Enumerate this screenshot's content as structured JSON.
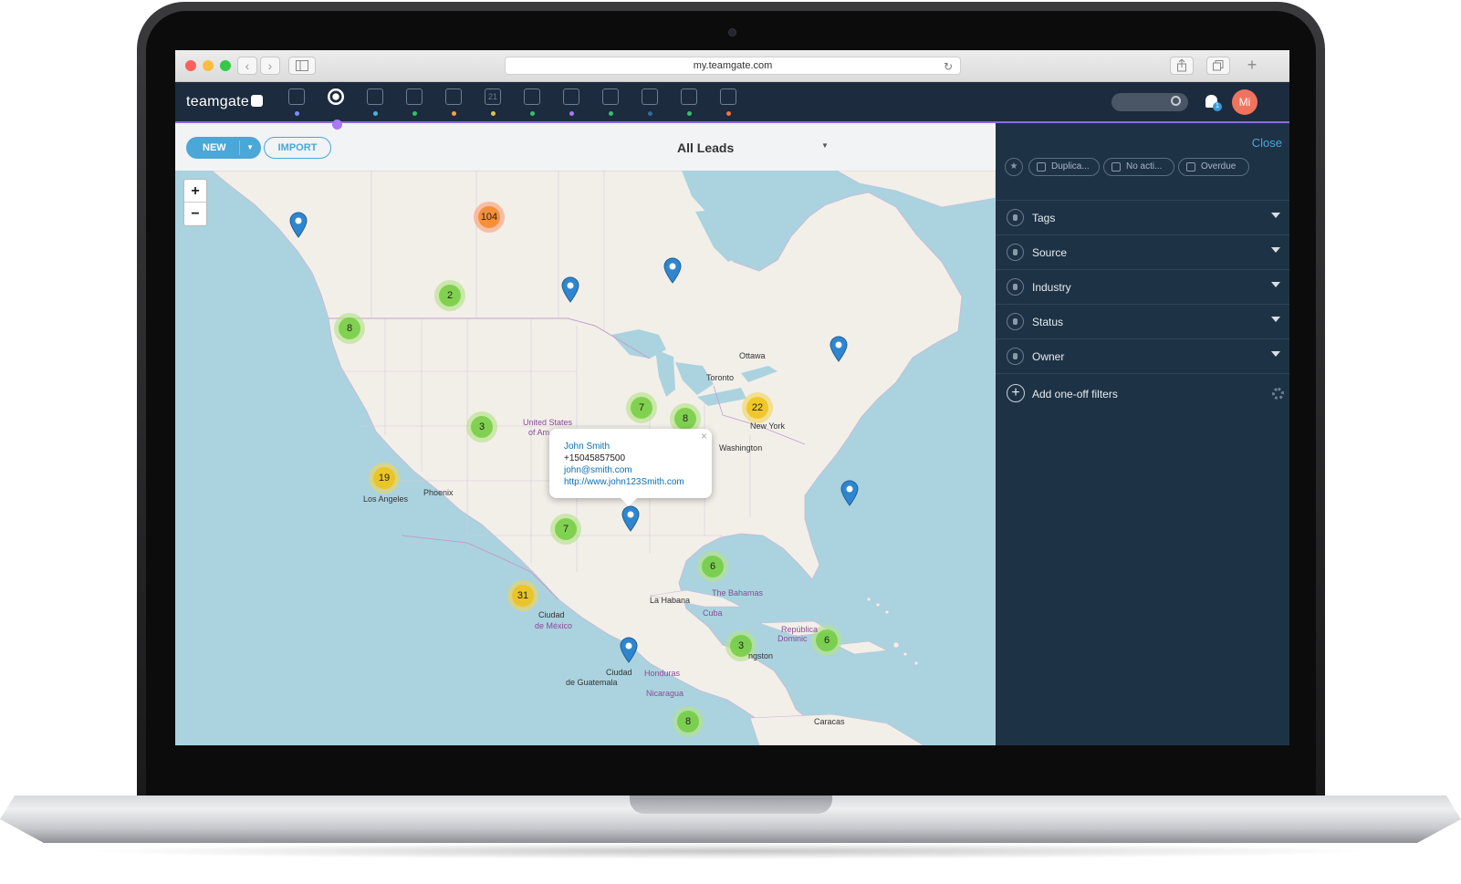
{
  "browser": {
    "url": "my.teamgate.com",
    "back": "‹",
    "forward": "›"
  },
  "app": {
    "logo": "teamgate",
    "nav_icons": [
      {
        "name": "dashboard-icon",
        "color": "#7d8cff"
      },
      {
        "name": "leads-icon",
        "color": "#a879f0"
      },
      {
        "name": "companies-icon",
        "color": "#45b6e8"
      },
      {
        "name": "contacts-icon",
        "color": "#35c06b"
      },
      {
        "name": "deals-icon",
        "color": "#f0a34a"
      },
      {
        "name": "calendar-icon",
        "color": "#e3c24a"
      },
      {
        "name": "activities-icon",
        "color": "#35c06b"
      },
      {
        "name": "inbox-icon",
        "color": "#a879f0"
      },
      {
        "name": "documents-icon",
        "color": "#35c06b"
      },
      {
        "name": "reports-icon",
        "color": "#2f6c95"
      },
      {
        "name": "chat-icon",
        "color": "#35c06b"
      },
      {
        "name": "settings-icon",
        "color": "#f0733e"
      }
    ],
    "calendar_day": "21",
    "notification_count": "1",
    "avatar_initials": "Mi"
  },
  "toolbar": {
    "new_label": "NEW",
    "import_label": "IMPORT",
    "view_title": "All Leads"
  },
  "map": {
    "zoom_in": "+",
    "zoom_out": "−",
    "clusters": [
      {
        "count": "104",
        "level": "orange"
      },
      {
        "count": "2",
        "level": "green"
      },
      {
        "count": "8",
        "level": "green"
      },
      {
        "count": "3",
        "level": "green"
      },
      {
        "count": "7",
        "level": "green"
      },
      {
        "count": "8",
        "level": "green"
      },
      {
        "count": "22",
        "level": "yellow"
      },
      {
        "count": "19",
        "level": "yellow"
      },
      {
        "count": "7",
        "level": "green"
      },
      {
        "count": "6",
        "level": "green"
      },
      {
        "count": "31",
        "level": "yellow"
      },
      {
        "count": "3",
        "level": "green"
      },
      {
        "count": "6",
        "level": "green"
      },
      {
        "count": "8",
        "level": "green"
      }
    ],
    "labels": [
      "Ottawa",
      "Toronto",
      "United States",
      "of Am",
      "New York",
      "Washington",
      "Los Angeles",
      "Phoenix",
      "La Habana",
      "The Bahamas",
      "Cuba",
      "Ciudad",
      "de México",
      "República",
      "Dominic",
      "ngston",
      "Ciudad",
      "de Guatemala",
      "Honduras",
      "Nicaragua",
      "Caracas"
    ],
    "popup": {
      "name": "John Smith",
      "phone": "+15045857500",
      "email": "john@smith.com",
      "website": "http://www.john123Smith.com",
      "close": "×"
    }
  },
  "panel": {
    "close_label": "Close",
    "chips": [
      "Duplica...",
      "No acti...",
      "Overdue"
    ],
    "filters": [
      "Tags",
      "Source",
      "Industry",
      "Status",
      "Owner"
    ],
    "add_filter_label": "Add one-off filters"
  }
}
